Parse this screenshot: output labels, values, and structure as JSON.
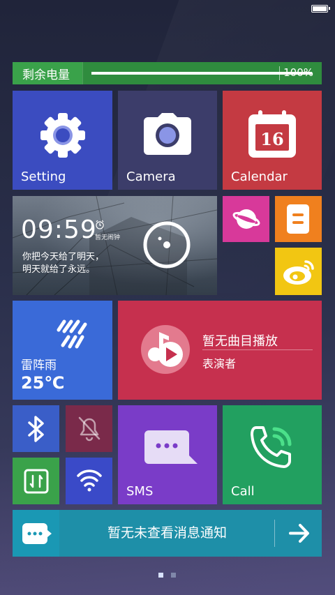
{
  "status_bar": {
    "battery_icon": "battery-full-icon"
  },
  "battery_banner": {
    "label": "剩余电量",
    "percent_text": "100%",
    "level": 1.0
  },
  "tiles": {
    "setting": {
      "label": "Setting",
      "icon": "gear-icon"
    },
    "camera": {
      "label": "Camera",
      "icon": "camera-icon"
    },
    "calendar": {
      "label": "Calendar",
      "icon": "calendar-icon",
      "day": "16"
    },
    "clock": {
      "time": "09:59",
      "alarm_label": "暂无闹钟",
      "quote_line1": "你把今天给了明天，",
      "quote_line2": "明天就给了永远。"
    },
    "planet": {
      "icon": "planet-icon"
    },
    "notes": {
      "icon": "note-icon"
    },
    "weibo": {
      "icon": "weibo-icon"
    },
    "weather": {
      "condition": "雷阵雨",
      "temperature": "25℃",
      "icon": "thunderstorm-icon"
    },
    "music": {
      "title": "暂无曲目播放",
      "artist": "表演者",
      "icon": "music-play-icon"
    },
    "bluetooth": {
      "icon": "bluetooth-icon"
    },
    "silent": {
      "icon": "bell-off-icon"
    },
    "data": {
      "icon": "mobile-data-icon"
    },
    "wifi": {
      "icon": "wifi-icon"
    },
    "sms": {
      "label": "SMS",
      "icon": "message-icon"
    },
    "call": {
      "label": "Call",
      "icon": "phone-icon"
    }
  },
  "notification": {
    "text": "暂无未查看消息通知",
    "icon": "chat-bubble-icon",
    "arrow_icon": "arrow-right-icon"
  },
  "pager": {
    "pages": 2,
    "current": 1
  },
  "colors": {
    "battery_green": "#3aa24a",
    "setting_blue": "#3b4cc0",
    "calendar_red": "#c43a42",
    "music_red": "#c6304e",
    "call_green": "#22a060",
    "sms_purple": "#7a3cc8",
    "notification_teal": "#1e8fa8"
  }
}
